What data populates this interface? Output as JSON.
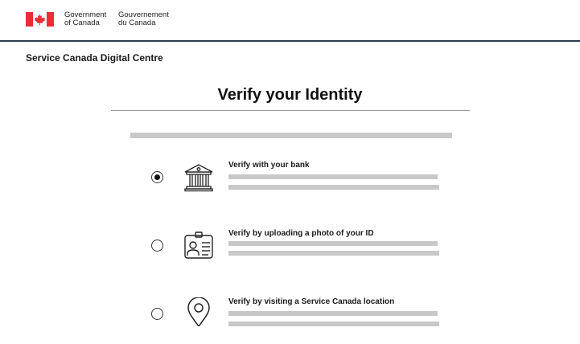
{
  "header": {
    "government_en": [
      "Government",
      "of Canada"
    ],
    "government_fr": [
      "Gouvernement",
      "du Canada"
    ],
    "colors": {
      "flag_red": "#eb2d37",
      "header_rule": "#2e3c4f"
    }
  },
  "service": {
    "title": "Service Canada Digital Centre"
  },
  "main": {
    "title": "Verify your Identity",
    "options": [
      {
        "label": "Verify with your bank",
        "icon": "bank-icon",
        "selected": true
      },
      {
        "label": "Verify by uploading a photo of your ID",
        "icon": "id-card-icon",
        "selected": false
      },
      {
        "label": "Verify by visiting a Service Canada location",
        "icon": "location-pin-icon",
        "selected": false
      }
    ]
  }
}
